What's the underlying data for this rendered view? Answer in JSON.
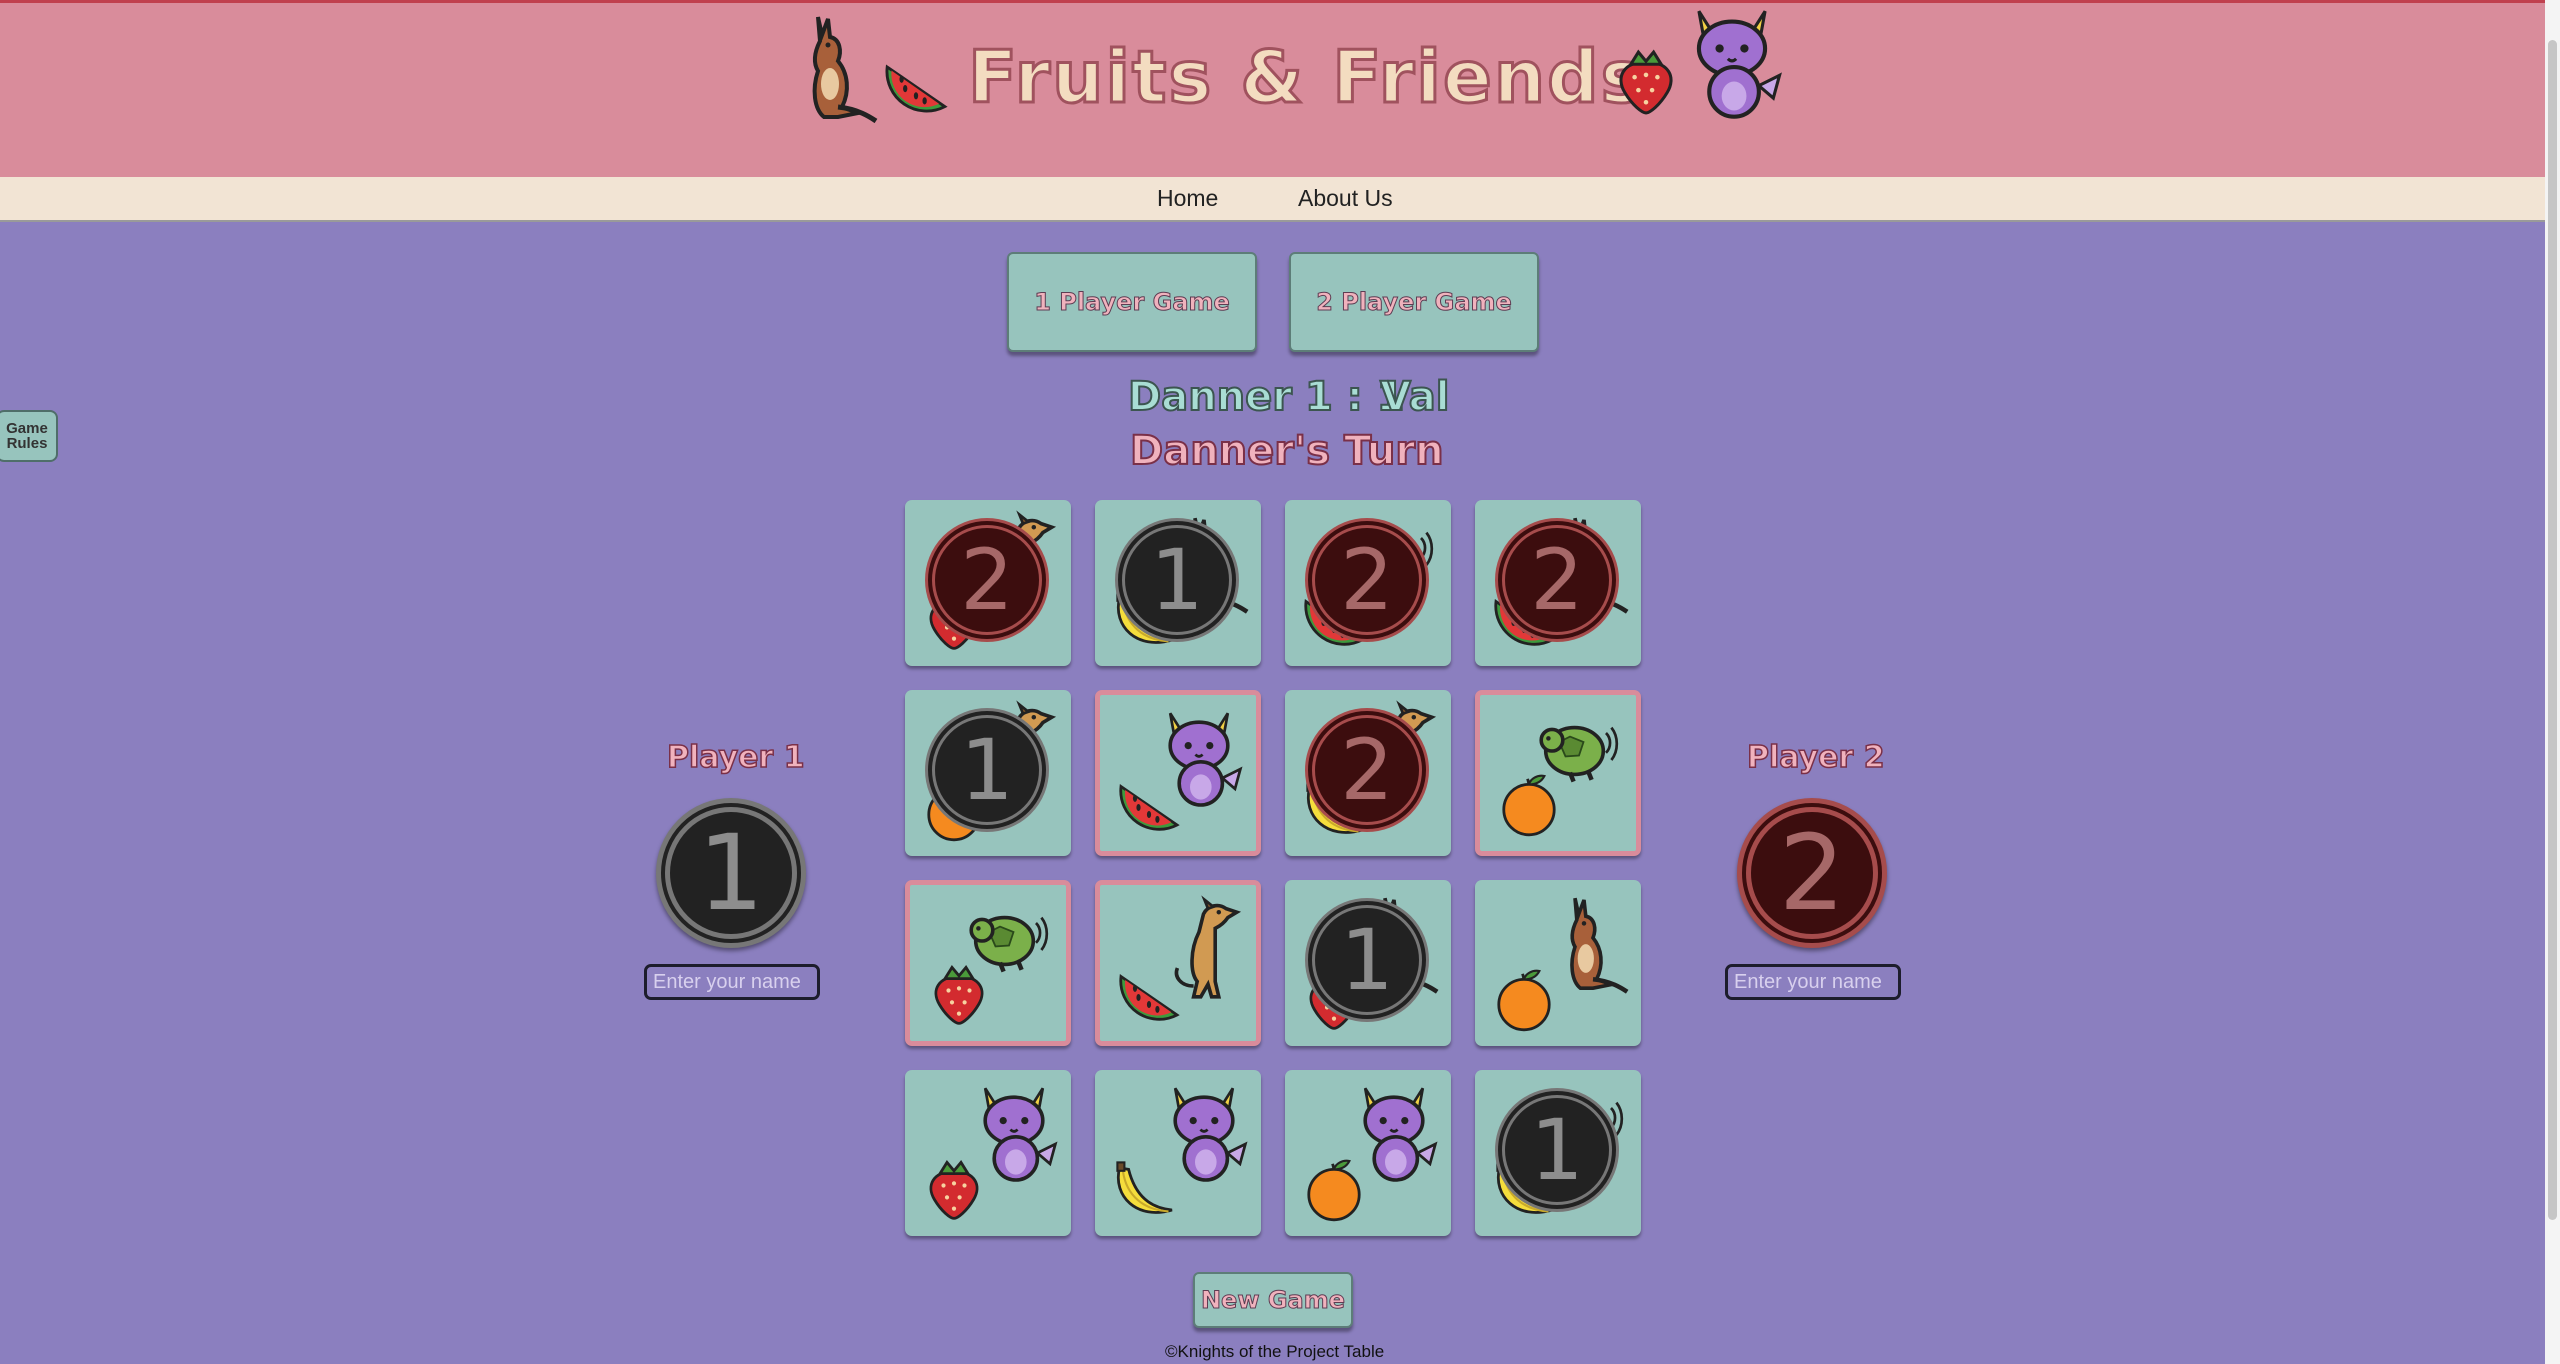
{
  "header": {
    "title": "Fruits & Friends"
  },
  "nav": {
    "home": "Home",
    "about": "About Us"
  },
  "buttons": {
    "one_player": "1 Player Game",
    "two_player": "2 Player Game",
    "new_game": "New Game",
    "rules": "Game Rules"
  },
  "scoreboard": {
    "player1_name": "Danner",
    "score": "1 : 1",
    "player2_name": "Val",
    "turn": "Danner's Turn"
  },
  "players": [
    {
      "label": "Player 1",
      "token": "1",
      "placeholder": "Enter your name"
    },
    {
      "label": "Player 2",
      "token": "2",
      "placeholder": "Enter your name"
    }
  ],
  "board": [
    {
      "fruit": "strawberry",
      "animal": "dog",
      "token": "2",
      "selected": false
    },
    {
      "fruit": "banana",
      "animal": "kangaroo",
      "token": "1",
      "selected": false
    },
    {
      "fruit": "watermelon",
      "animal": "turtle",
      "token": "2",
      "selected": false
    },
    {
      "fruit": "watermelon",
      "animal": "kangaroo",
      "token": "2",
      "selected": false
    },
    {
      "fruit": "orange",
      "animal": "dog",
      "token": "1",
      "selected": false
    },
    {
      "fruit": "watermelon",
      "animal": "dragon",
      "token": "",
      "selected": true
    },
    {
      "fruit": "banana",
      "animal": "dog",
      "token": "2",
      "selected": false
    },
    {
      "fruit": "orange",
      "animal": "turtle",
      "token": "",
      "selected": true
    },
    {
      "fruit": "strawberry",
      "animal": "turtle",
      "token": "",
      "selected": true
    },
    {
      "fruit": "watermelon",
      "animal": "dog",
      "token": "",
      "selected": true
    },
    {
      "fruit": "strawberry",
      "animal": "kangaroo",
      "token": "1",
      "selected": false
    },
    {
      "fruit": "orange",
      "animal": "kangaroo",
      "token": "",
      "selected": false
    },
    {
      "fruit": "strawberry",
      "animal": "dragon",
      "token": "",
      "selected": false
    },
    {
      "fruit": "banana",
      "animal": "dragon",
      "token": "",
      "selected": false
    },
    {
      "fruit": "orange",
      "animal": "dragon",
      "token": "",
      "selected": false
    },
    {
      "fruit": "banana",
      "animal": "turtle",
      "token": "1",
      "selected": false
    }
  ],
  "footer": {
    "text": "©Knights of the Project Table"
  },
  "colors": {
    "background": "#8b7fbf",
    "header": "#d98c9b",
    "card": "#97c4bd",
    "highlight": "#d98c9b"
  }
}
